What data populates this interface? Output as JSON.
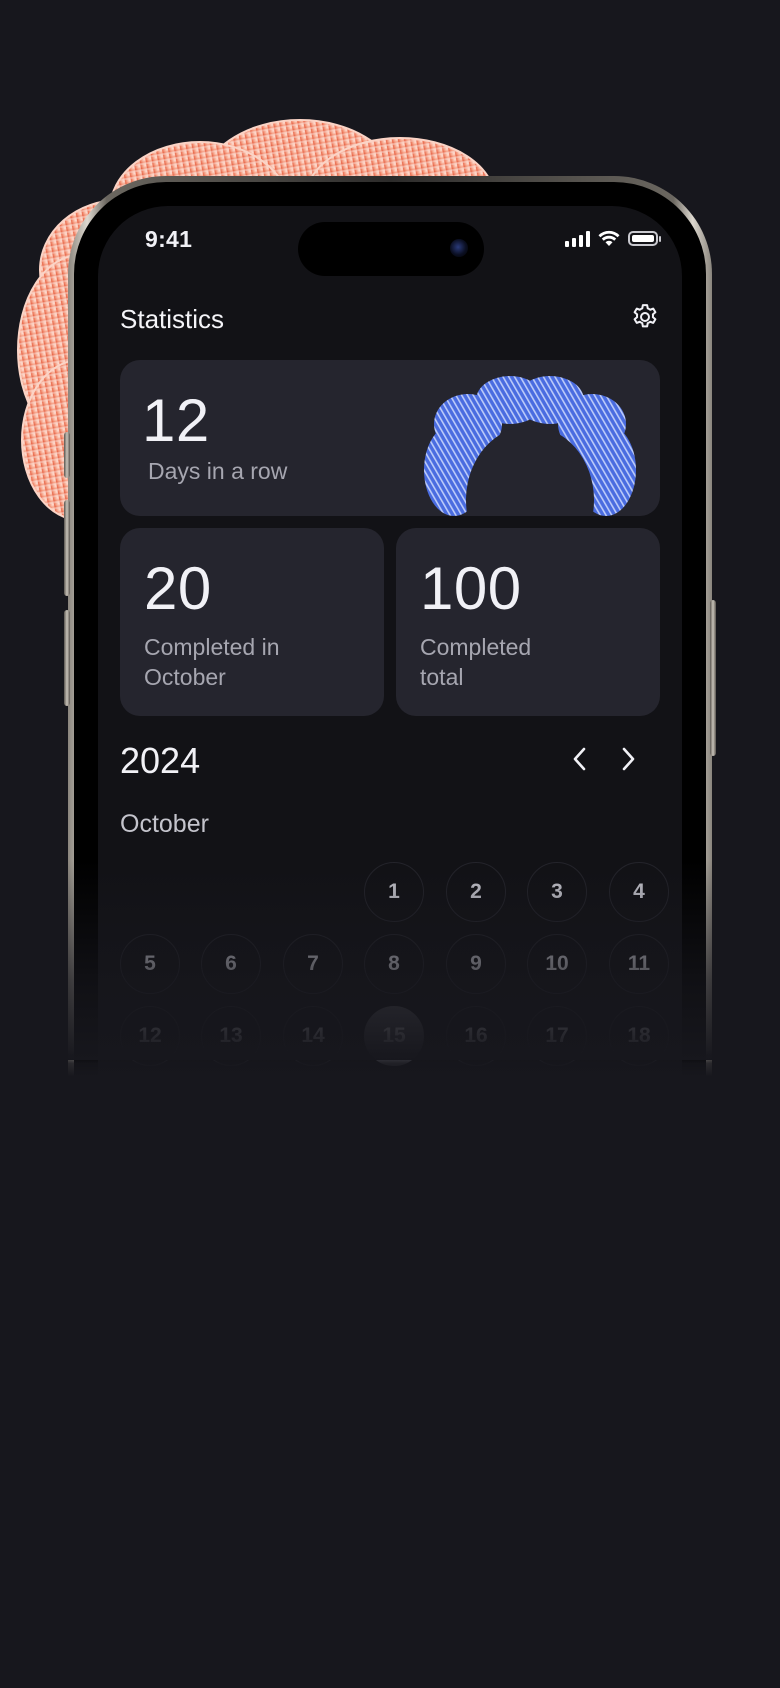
{
  "status_bar": {
    "time": "9:41"
  },
  "header": {
    "title": "Statistics",
    "settings_icon": "gear-icon"
  },
  "streak_card": {
    "value": "12",
    "label": "Days in a row"
  },
  "month_card": {
    "value": "20",
    "label_line1": "Completed in",
    "label_line2": "October"
  },
  "total_card": {
    "value": "100",
    "label_line1": "Completed",
    "label_line2": "total"
  },
  "calendar": {
    "year": "2024",
    "month": "October",
    "prev_icon": "chevron-left-icon",
    "next_icon": "chevron-right-icon",
    "week1": [
      "1",
      "2",
      "3",
      "4"
    ],
    "week2": [
      "5",
      "6",
      "7",
      "8",
      "9",
      "10",
      "11"
    ],
    "week3": [
      "12",
      "13",
      "14",
      "15",
      "16",
      "17",
      "18"
    ],
    "today": "15"
  },
  "colors": {
    "background": "#17171d",
    "card": "#25252e",
    "accent_blue": "#4a6ce0",
    "accent_coral": "#f08a6e"
  }
}
